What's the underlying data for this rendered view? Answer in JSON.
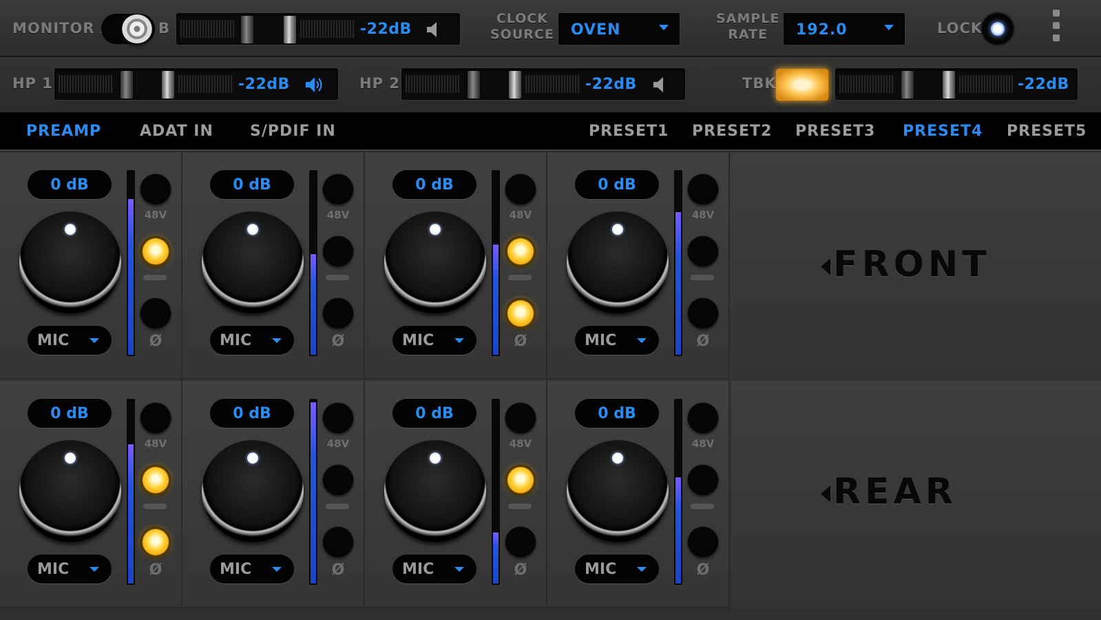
{
  "monitor": {
    "label": "MONITOR",
    "a_label": "A",
    "b_label": "B",
    "level": "-22dB"
  },
  "clock": {
    "label_line1": "CLOCK",
    "label_line2": "SOURCE",
    "value": "OVEN"
  },
  "sample_rate": {
    "label_line1": "SAMPLE",
    "label_line2": "RATE",
    "value": "192.0"
  },
  "lock": {
    "label": "LOCK"
  },
  "hp1": {
    "label": "HP 1",
    "level": "-22dB"
  },
  "hp2": {
    "label": "HP 2",
    "level": "-22dB"
  },
  "talkback": {
    "label": "TBK",
    "level": "-22dB"
  },
  "tabs": [
    "PREAMP",
    "ADAT IN",
    "S/PDIF IN",
    "PRESET1",
    "PRESET2",
    "PRESET3",
    "PRESET4",
    "PRESET5"
  ],
  "active_tab": "PREAMP",
  "active_preset": "PRESET4",
  "sections": {
    "front": "FRONT",
    "rear": "REAR"
  },
  "labels": {
    "phantom": "48V",
    "phase": "Ø"
  },
  "channels": [
    {
      "gain": "0 dB",
      "source": "MIC",
      "meter": 0.85,
      "phantom_on": true,
      "phase_on": false
    },
    {
      "gain": "0 dB",
      "source": "MIC",
      "meter": 0.55,
      "phantom_on": false,
      "phase_on": false
    },
    {
      "gain": "0 dB",
      "source": "MIC",
      "meter": 0.6,
      "phantom_on": true,
      "phase_on": true
    },
    {
      "gain": "0 dB",
      "source": "MIC",
      "meter": 0.78,
      "phantom_on": false,
      "phase_on": false
    },
    {
      "gain": "0 dB",
      "source": "MIC",
      "meter": 0.76,
      "phantom_on": true,
      "phase_on": true
    },
    {
      "gain": "0 dB",
      "source": "MIC",
      "meter": 0.99,
      "phantom_on": false,
      "phase_on": false
    },
    {
      "gain": "0 dB",
      "source": "MIC",
      "meter": 0.28,
      "phantom_on": true,
      "phase_on": false
    },
    {
      "gain": "0 dB",
      "source": "MIC",
      "meter": 0.58,
      "phantom_on": false,
      "phase_on": false
    }
  ],
  "colors": {
    "accent": "#2a8cf0",
    "led_on": "#ffc21a",
    "background": "#2a2a2a"
  }
}
